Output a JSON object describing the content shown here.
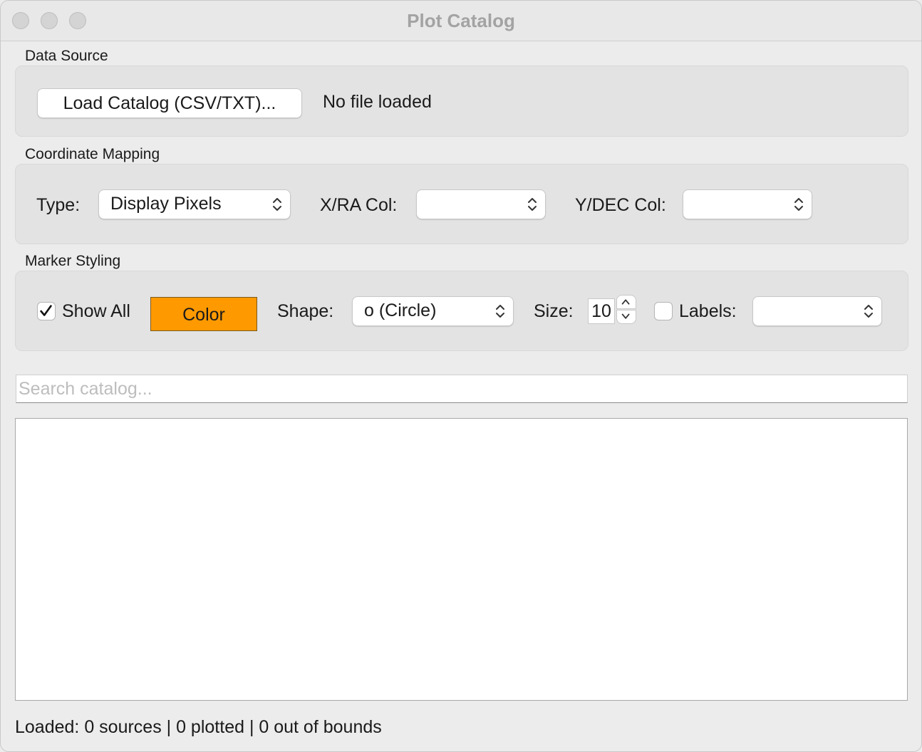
{
  "window": {
    "title": "Plot Catalog",
    "traffic_lights": [
      "close-icon",
      "minimize-icon",
      "zoom-icon"
    ]
  },
  "data_source": {
    "section_label": "Data Source",
    "load_button_label": "Load Catalog (CSV/TXT)...",
    "file_status": "No file loaded"
  },
  "coordinate_mapping": {
    "section_label": "Coordinate Mapping",
    "type_label": "Type:",
    "type_value": "Display Pixels",
    "x_col_label": "X/RA Col:",
    "x_col_value": "",
    "y_col_label": "Y/DEC Col:",
    "y_col_value": ""
  },
  "marker_styling": {
    "section_label": "Marker Styling",
    "show_all_label": "Show All",
    "show_all_checked": true,
    "color_button_label": "Color",
    "color_value": "#ff9900",
    "shape_label": "Shape:",
    "shape_value": "o (Circle)",
    "size_label": "Size:",
    "size_value": "10",
    "labels_label": "Labels:",
    "labels_checked": false,
    "labels_value": ""
  },
  "search": {
    "placeholder": "Search catalog..."
  },
  "status_bar": {
    "text": "Loaded: 0 sources | 0 plotted | 0 out of bounds"
  }
}
